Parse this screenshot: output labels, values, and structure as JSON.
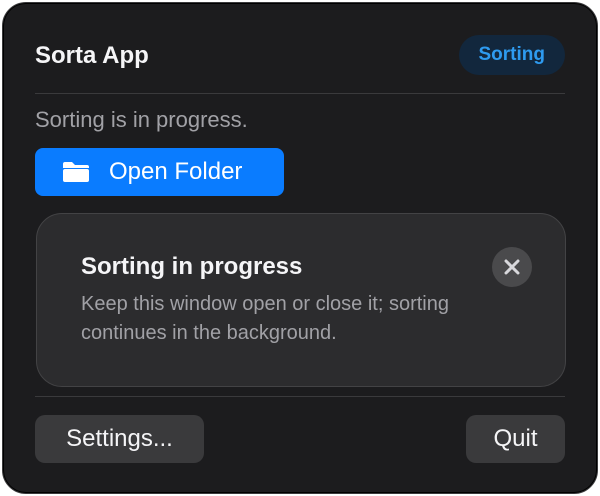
{
  "app": {
    "title": "Sorta App",
    "status_badge": "Sorting",
    "status_text": "Sorting is in progress."
  },
  "actions": {
    "open_folder_label": "Open Folder",
    "open_folder_icon": "folder-icon"
  },
  "notice": {
    "title": "Sorting in progress",
    "body": "Keep this window open or close it; sorting continues in the background.",
    "close_icon": "close-icon"
  },
  "footer": {
    "settings_label": "Settings...",
    "quit_label": "Quit"
  },
  "colors": {
    "accent": "#0a7cff",
    "badge_text": "#2e9bf0",
    "badge_bg": "#12273d",
    "window_bg": "#1c1c1e",
    "card_bg": "#2c2c2e"
  }
}
